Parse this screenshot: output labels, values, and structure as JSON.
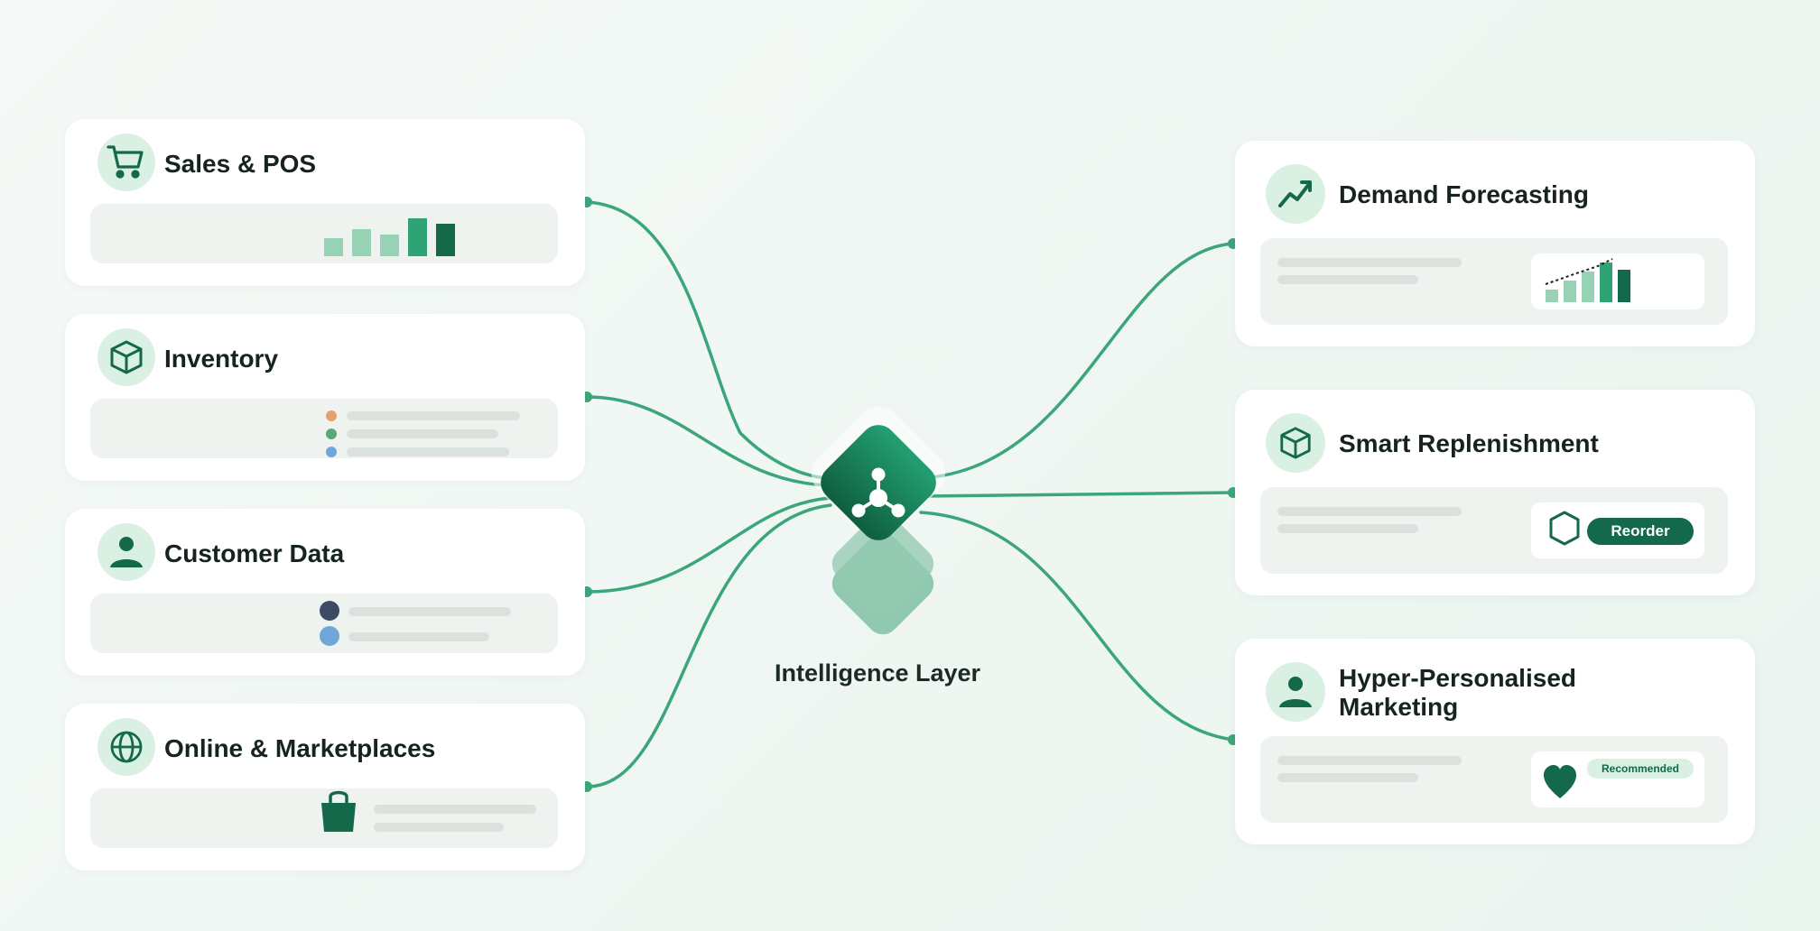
{
  "inputs": [
    {
      "title": "Sales & POS",
      "icon": "cart-icon"
    },
    {
      "title": "Inventory",
      "icon": "box-icon"
    },
    {
      "title": "Customer Data",
      "icon": "person-icon"
    },
    {
      "title": "Online & Marketplaces",
      "icon": "globe-icon"
    }
  ],
  "outputs": [
    {
      "title": "Demand Forecasting",
      "icon": "trend-up-icon"
    },
    {
      "title": "Smart Replenishment",
      "icon": "box-icon",
      "button_label": "Reorder"
    },
    {
      "title_line1": "Hyper-Personalised",
      "title_line2": "Marketing",
      "icon": "person-icon",
      "badge_label": "Recommended"
    }
  ],
  "center": {
    "label": "Intelligence Layer",
    "icon": "network-hub-icon"
  },
  "colors": {
    "accent": "#13694a",
    "accent_mid": "#2fa374",
    "accent_light": "#97d2b4",
    "connector": "#3aa679",
    "icon_bg": "#d9f0e3",
    "panel_bg": "#eef3f0",
    "dot_orange": "#e5a06b",
    "dot_green": "#5aa878",
    "dot_blue": "#6fa8d8",
    "avatar_dark": "#3c4a66",
    "avatar_light": "#6fa8d8"
  }
}
